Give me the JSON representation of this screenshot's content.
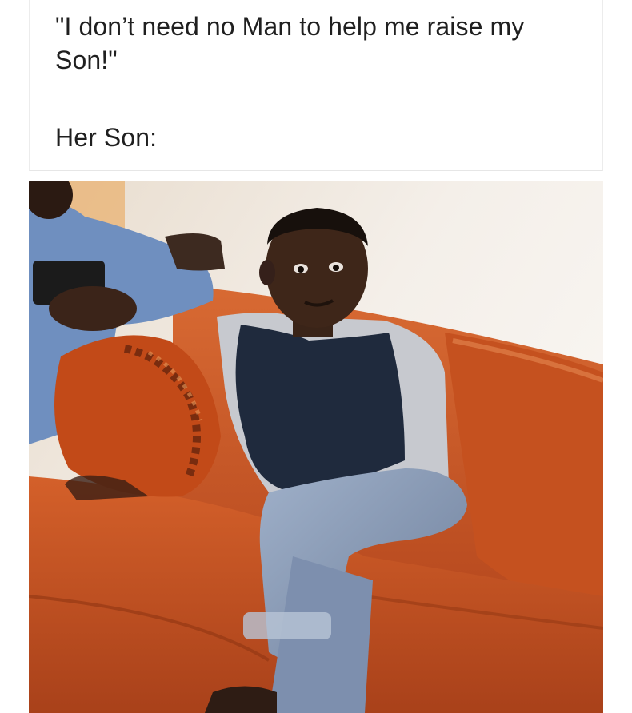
{
  "caption": {
    "quote": "\"I don’t need no Man to help me raise my Son!\"",
    "reply": "Her Son:"
  },
  "photo": {
    "subject": "boy sitting cross-legged on an orange sofa",
    "colors": {
      "sofa": "#c9531f",
      "wall": "#efe9e2",
      "shirt": "#1f2a3d",
      "jeans": "#8a9cb8",
      "skin": "#3a2418"
    }
  }
}
